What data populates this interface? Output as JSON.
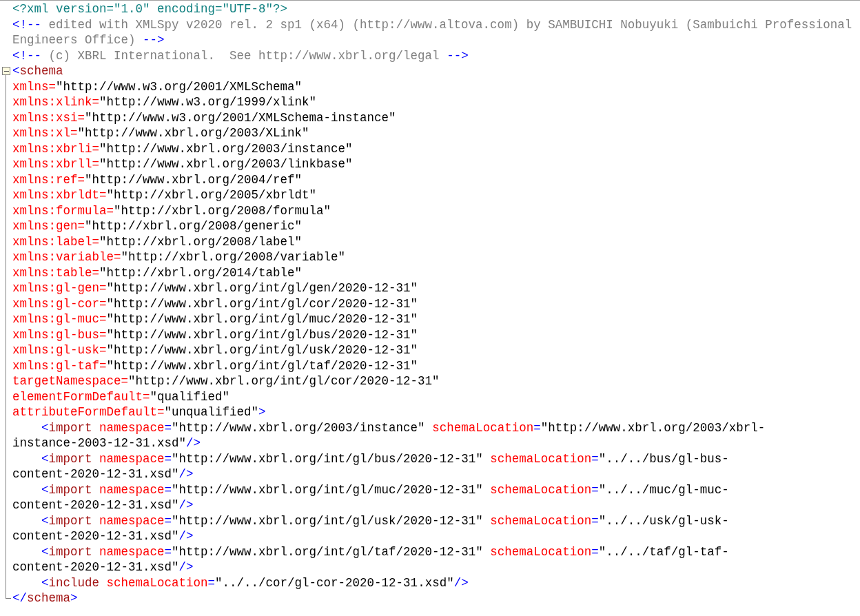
{
  "editor": {
    "lines": [
      {
        "tokens": [
          {
            "kind": "pi",
            "text": "<?xml version=\"1.0\" encoding=\"UTF-8\"?>"
          }
        ]
      },
      {
        "tokens": [
          {
            "kind": "punct",
            "text": "<!--"
          },
          {
            "kind": "comment",
            "text": " edited with XMLSpy v2020 rel. 2 sp1 (x64) (http://www.altova.com) by SAMBUICHI Nobuyuki (Sambuichi Professional"
          }
        ]
      },
      {
        "tokens": [
          {
            "kind": "comment",
            "text": "Engineers Office) "
          },
          {
            "kind": "punct",
            "text": "-->"
          }
        ]
      },
      {
        "tokens": [
          {
            "kind": "punct",
            "text": "<!--"
          },
          {
            "kind": "comment",
            "text": " (c) XBRL International.  See http://www.xbrl.org/legal "
          },
          {
            "kind": "punct",
            "text": "-->"
          }
        ]
      },
      {
        "expanded": true,
        "tokens": [
          {
            "kind": "punct",
            "text": "<"
          },
          {
            "kind": "tag",
            "text": "schema"
          }
        ]
      },
      {
        "tokens": [
          {
            "kind": "attr",
            "text": "xmlns="
          },
          {
            "kind": "value",
            "text": "\"http://www.w3.org/2001/XMLSchema\""
          }
        ]
      },
      {
        "tokens": [
          {
            "kind": "attr",
            "text": "xmlns:xlink="
          },
          {
            "kind": "value",
            "text": "\"http://www.w3.org/1999/xlink\""
          }
        ]
      },
      {
        "tokens": [
          {
            "kind": "attr",
            "text": "xmlns:xsi="
          },
          {
            "kind": "value",
            "text": "\"http://www.w3.org/2001/XMLSchema-instance\""
          }
        ]
      },
      {
        "tokens": [
          {
            "kind": "attr",
            "text": "xmlns:xl="
          },
          {
            "kind": "value",
            "text": "\"http://www.xbrl.org/2003/XLink\""
          }
        ]
      },
      {
        "tokens": [
          {
            "kind": "attr",
            "text": "xmlns:xbrli="
          },
          {
            "kind": "value",
            "text": "\"http://www.xbrl.org/2003/instance\""
          }
        ]
      },
      {
        "tokens": [
          {
            "kind": "attr",
            "text": "xmlns:xbrll="
          },
          {
            "kind": "value",
            "text": "\"http://www.xbrl.org/2003/linkbase\""
          }
        ]
      },
      {
        "tokens": [
          {
            "kind": "attr",
            "text": "xmlns:ref="
          },
          {
            "kind": "value",
            "text": "\"http://www.xbrl.org/2004/ref\""
          }
        ]
      },
      {
        "tokens": [
          {
            "kind": "attr",
            "text": "xmlns:xbrldt="
          },
          {
            "kind": "value",
            "text": "\"http://xbrl.org/2005/xbrldt\""
          }
        ]
      },
      {
        "tokens": [
          {
            "kind": "attr",
            "text": "xmlns:formula="
          },
          {
            "kind": "value",
            "text": "\"http://xbrl.org/2008/formula\""
          }
        ]
      },
      {
        "tokens": [
          {
            "kind": "attr",
            "text": "xmlns:gen="
          },
          {
            "kind": "value",
            "text": "\"http://xbrl.org/2008/generic\""
          }
        ]
      },
      {
        "tokens": [
          {
            "kind": "attr",
            "text": "xmlns:label="
          },
          {
            "kind": "value",
            "text": "\"http://xbrl.org/2008/label\""
          }
        ]
      },
      {
        "tokens": [
          {
            "kind": "attr",
            "text": "xmlns:variable="
          },
          {
            "kind": "value",
            "text": "\"http://xbrl.org/2008/variable\""
          }
        ]
      },
      {
        "tokens": [
          {
            "kind": "attr",
            "text": "xmlns:table="
          },
          {
            "kind": "value",
            "text": "\"http://xbrl.org/2014/table\""
          }
        ]
      },
      {
        "tokens": [
          {
            "kind": "attr",
            "text": "xmlns:gl-gen="
          },
          {
            "kind": "value",
            "text": "\"http://www.xbrl.org/int/gl/gen/2020-12-31\""
          }
        ]
      },
      {
        "tokens": [
          {
            "kind": "attr",
            "text": "xmlns:gl-cor="
          },
          {
            "kind": "value",
            "text": "\"http://www.xbrl.org/int/gl/cor/2020-12-31\""
          }
        ]
      },
      {
        "tokens": [
          {
            "kind": "attr",
            "text": "xmlns:gl-muc="
          },
          {
            "kind": "value",
            "text": "\"http://www.xbrl.org/int/gl/muc/2020-12-31\""
          }
        ]
      },
      {
        "tokens": [
          {
            "kind": "attr",
            "text": "xmlns:gl-bus="
          },
          {
            "kind": "value",
            "text": "\"http://www.xbrl.org/int/gl/bus/2020-12-31\""
          }
        ]
      },
      {
        "tokens": [
          {
            "kind": "attr",
            "text": "xmlns:gl-usk="
          },
          {
            "kind": "value",
            "text": "\"http://www.xbrl.org/int/gl/usk/2020-12-31\""
          }
        ]
      },
      {
        "tokens": [
          {
            "kind": "attr",
            "text": "xmlns:gl-taf="
          },
          {
            "kind": "value",
            "text": "\"http://www.xbrl.org/int/gl/taf/2020-12-31\""
          }
        ]
      },
      {
        "tokens": [
          {
            "kind": "attr",
            "text": "targetNamespace="
          },
          {
            "kind": "value",
            "text": "\"http://www.xbrl.org/int/gl/cor/2020-12-31\""
          }
        ]
      },
      {
        "tokens": [
          {
            "kind": "attr",
            "text": "elementFormDefault="
          },
          {
            "kind": "value",
            "text": "\"qualified\""
          }
        ]
      },
      {
        "tokens": [
          {
            "kind": "attr",
            "text": "attributeFormDefault="
          },
          {
            "kind": "value",
            "text": "\"unqualified\""
          },
          {
            "kind": "punct",
            "text": ">"
          }
        ]
      },
      {
        "tokens": [
          {
            "kind": "punct",
            "text": "    <"
          },
          {
            "kind": "tag",
            "text": "import "
          },
          {
            "kind": "attr",
            "text": "namespace"
          },
          {
            "kind": "punct",
            "text": "="
          },
          {
            "kind": "value",
            "text": "\"http://www.xbrl.org/2003/instance\" "
          },
          {
            "kind": "attr",
            "text": "schemaLocation"
          },
          {
            "kind": "punct",
            "text": "="
          },
          {
            "kind": "value",
            "text": "\"http://www.xbrl.org/2003/xbrl-"
          }
        ]
      },
      {
        "tokens": [
          {
            "kind": "value",
            "text": "instance-2003-12-31.xsd\""
          },
          {
            "kind": "punct",
            "text": "/>"
          }
        ]
      },
      {
        "tokens": [
          {
            "kind": "punct",
            "text": "    <"
          },
          {
            "kind": "tag",
            "text": "import "
          },
          {
            "kind": "attr",
            "text": "namespace"
          },
          {
            "kind": "punct",
            "text": "="
          },
          {
            "kind": "value",
            "text": "\"http://www.xbrl.org/int/gl/bus/2020-12-31\" "
          },
          {
            "kind": "attr",
            "text": "schemaLocation"
          },
          {
            "kind": "punct",
            "text": "="
          },
          {
            "kind": "value",
            "text": "\"../../bus/gl-bus-"
          }
        ]
      },
      {
        "tokens": [
          {
            "kind": "value",
            "text": "content-2020-12-31.xsd\""
          },
          {
            "kind": "punct",
            "text": "/>"
          }
        ]
      },
      {
        "tokens": [
          {
            "kind": "punct",
            "text": "    <"
          },
          {
            "kind": "tag",
            "text": "import "
          },
          {
            "kind": "attr",
            "text": "namespace"
          },
          {
            "kind": "punct",
            "text": "="
          },
          {
            "kind": "value",
            "text": "\"http://www.xbrl.org/int/gl/muc/2020-12-31\" "
          },
          {
            "kind": "attr",
            "text": "schemaLocation"
          },
          {
            "kind": "punct",
            "text": "="
          },
          {
            "kind": "value",
            "text": "\"../../muc/gl-muc-"
          }
        ]
      },
      {
        "tokens": [
          {
            "kind": "value",
            "text": "content-2020-12-31.xsd\""
          },
          {
            "kind": "punct",
            "text": "/>"
          }
        ]
      },
      {
        "tokens": [
          {
            "kind": "punct",
            "text": "    <"
          },
          {
            "kind": "tag",
            "text": "import "
          },
          {
            "kind": "attr",
            "text": "namespace"
          },
          {
            "kind": "punct",
            "text": "="
          },
          {
            "kind": "value",
            "text": "\"http://www.xbrl.org/int/gl/usk/2020-12-31\" "
          },
          {
            "kind": "attr",
            "text": "schemaLocation"
          },
          {
            "kind": "punct",
            "text": "="
          },
          {
            "kind": "value",
            "text": "\"../../usk/gl-usk-"
          }
        ]
      },
      {
        "tokens": [
          {
            "kind": "value",
            "text": "content-2020-12-31.xsd\""
          },
          {
            "kind": "punct",
            "text": "/>"
          }
        ]
      },
      {
        "tokens": [
          {
            "kind": "punct",
            "text": "    <"
          },
          {
            "kind": "tag",
            "text": "import "
          },
          {
            "kind": "attr",
            "text": "namespace"
          },
          {
            "kind": "punct",
            "text": "="
          },
          {
            "kind": "value",
            "text": "\"http://www.xbrl.org/int/gl/taf/2020-12-31\" "
          },
          {
            "kind": "attr",
            "text": "schemaLocation"
          },
          {
            "kind": "punct",
            "text": "="
          },
          {
            "kind": "value",
            "text": "\"../../taf/gl-taf-"
          }
        ]
      },
      {
        "tokens": [
          {
            "kind": "value",
            "text": "content-2020-12-31.xsd\""
          },
          {
            "kind": "punct",
            "text": "/>"
          }
        ]
      },
      {
        "tokens": [
          {
            "kind": "punct",
            "text": "    <"
          },
          {
            "kind": "tag",
            "text": "include "
          },
          {
            "kind": "attr",
            "text": "schemaLocation"
          },
          {
            "kind": "punct",
            "text": "="
          },
          {
            "kind": "value",
            "text": "\"../../cor/gl-cor-2020-12-31.xsd\""
          },
          {
            "kind": "punct",
            "text": "/>"
          }
        ]
      },
      {
        "tokens": [
          {
            "kind": "punct",
            "text": "</"
          },
          {
            "kind": "tag",
            "text": "schema"
          },
          {
            "kind": "punct",
            "text": ">"
          }
        ]
      }
    ]
  }
}
